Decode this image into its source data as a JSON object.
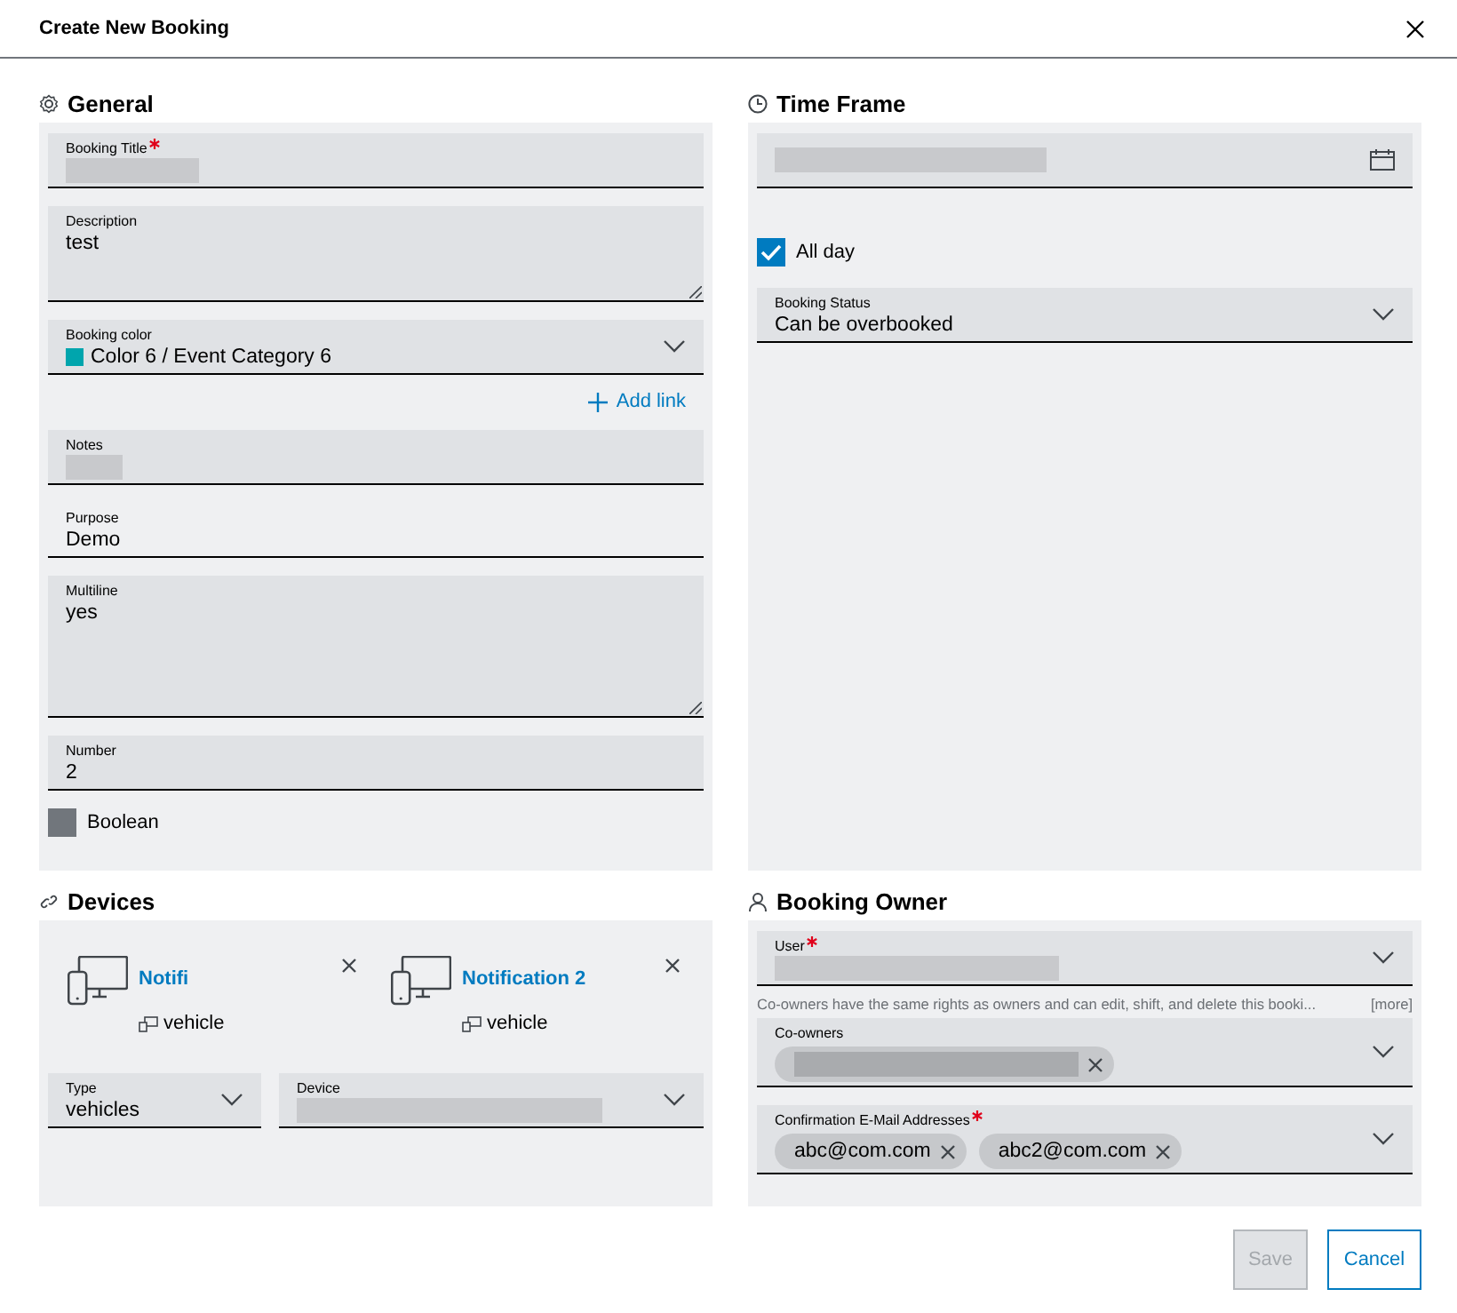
{
  "dialog": {
    "title": "Create New Booking"
  },
  "general": {
    "title": "General",
    "fields": [
      {
        "kind": "text",
        "label": "Booking Title",
        "required": true,
        "redacted": true
      },
      {
        "kind": "textarea",
        "label": "Description",
        "value": "test"
      },
      {
        "kind": "select",
        "label": "Booking color",
        "value": "Color 6 / Event Category 6",
        "color": "#00a5ad"
      },
      {
        "kind": "link",
        "label": "Add link"
      },
      {
        "kind": "text",
        "label": "Notes",
        "redacted": true
      },
      {
        "kind": "text",
        "label": "Purpose",
        "value": "Demo",
        "readonly": true
      },
      {
        "kind": "textarea",
        "label": "Multiline",
        "value": "yes",
        "tall": true
      },
      {
        "kind": "text",
        "label": "Number",
        "value": "2"
      },
      {
        "kind": "checkbox",
        "label": "Boolean",
        "checked": false
      }
    ]
  },
  "time_frame": {
    "title": "Time Frame",
    "fields": [
      {
        "kind": "date",
        "redacted": true
      },
      {
        "kind": "checkbox",
        "label": "All day",
        "checked": true
      },
      {
        "kind": "select",
        "label": "Booking Status",
        "value": "Can be overbooked"
      }
    ]
  },
  "devices": {
    "title": "Devices",
    "items": [
      {
        "name": "Notifi",
        "type": "vehicle"
      },
      {
        "name": "Notification 2",
        "type": "vehicle"
      }
    ],
    "fields": [
      {
        "kind": "select",
        "label": "Type",
        "value": "vehicles"
      },
      {
        "kind": "select",
        "label": "Device",
        "redacted": true
      }
    ]
  },
  "booking_owner": {
    "title": "Booking Owner",
    "fields": [
      {
        "kind": "select",
        "label": "User",
        "required": true,
        "redacted": true
      },
      {
        "kind": "hint",
        "text": "Co-owners have the same rights as owners and can edit, shift, and delete this booki...",
        "more": "[more]"
      },
      {
        "kind": "chips",
        "label": "Co-owners",
        "chips": [
          {
            "redacted": true
          }
        ]
      },
      {
        "kind": "chips",
        "label": "Confirmation E-Mail Addresses",
        "required": true,
        "chips": [
          {
            "text": "abc@com.com"
          },
          {
            "text": "abc2@com.com"
          }
        ]
      }
    ]
  },
  "buttons": [
    {
      "label": "Save",
      "disabled": true
    },
    {
      "label": "Cancel",
      "disabled": false
    }
  ]
}
